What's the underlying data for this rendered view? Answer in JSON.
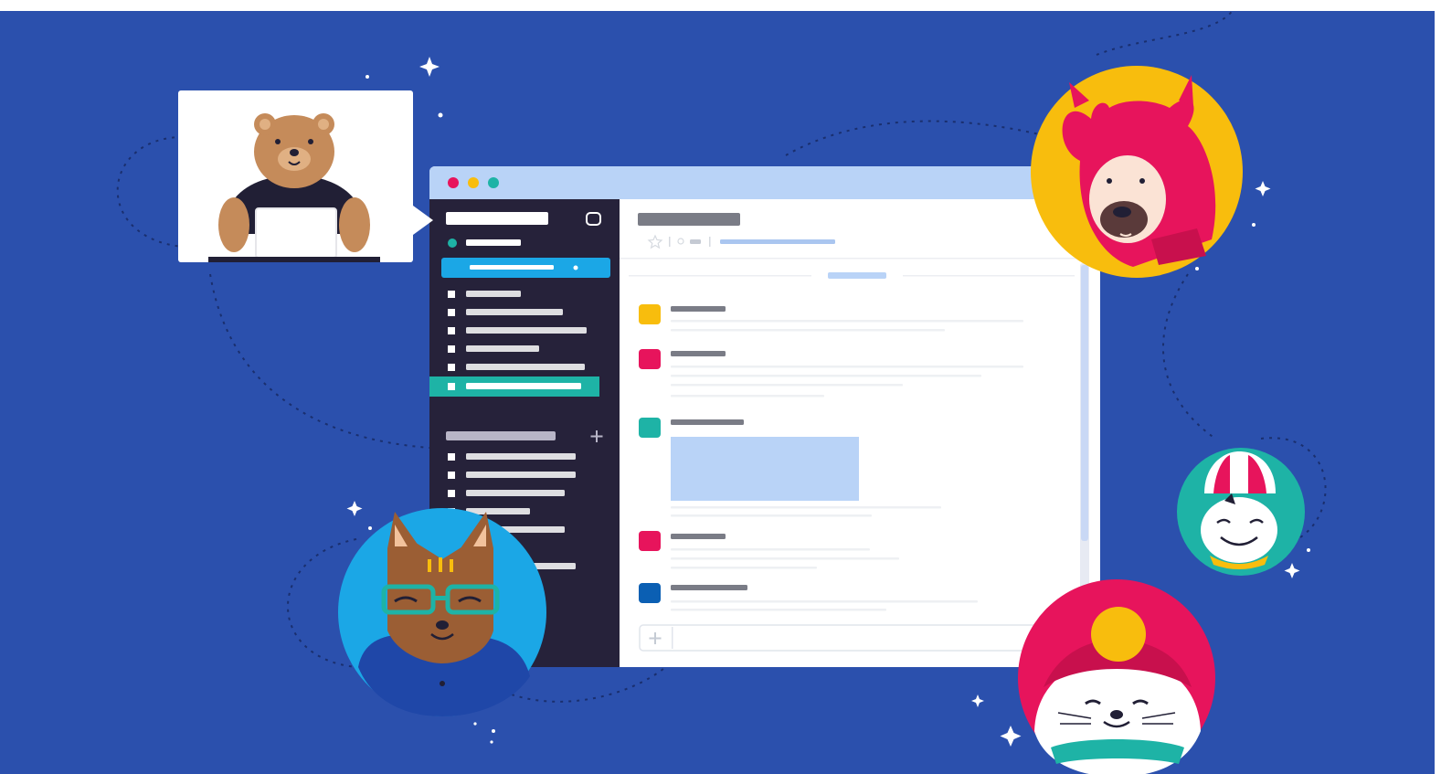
{
  "palette": {
    "background": "#2b50ad",
    "sidebar": "#26223a",
    "accent_blue": "#1ba7e6",
    "accent_teal": "#1eb3a6",
    "titlebar": "#b9d3f7",
    "yellow": "#f8bd0d",
    "pink": "#e7145c",
    "dark_blue": "#0b5fb3",
    "panel": "#ffffff"
  },
  "window": {
    "traffic_lights": [
      "#e7145c",
      "#f8bd0d",
      "#1eb3a6"
    ]
  },
  "sidebar": {
    "top_icon": "square-toggle-icon",
    "section_add_icon": "plus-icon"
  },
  "messages": {
    "avatar_colors": [
      "#f8bd0d",
      "#e7145c",
      "#1eb3a6",
      "#e7145c",
      "#0b5fb3"
    ]
  },
  "composer": {
    "add_icon": "plus-icon"
  },
  "characters": {
    "bear": "bear-with-laptop",
    "llama": "pink-llama",
    "cat": "cat-with-glasses",
    "bunny": "bunny-with-hat",
    "seal": "seal-with-beanie"
  }
}
